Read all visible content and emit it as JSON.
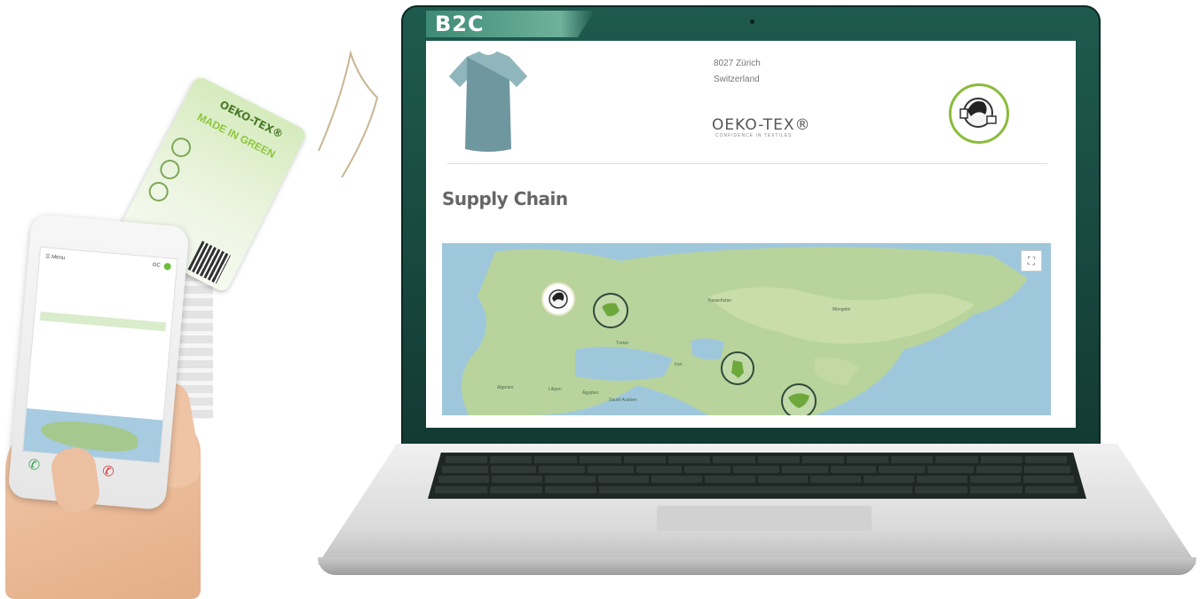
{
  "laptop": {
    "banner_label": "B2C",
    "page": {
      "address_line1": "8027 Zürich",
      "address_line2": "Switzerland",
      "logo_text": "OEKO-TEX®",
      "logo_subtitle": "CONFIDENCE IN TEXTILES",
      "section_title": "Supply Chain",
      "map": {
        "fullscreen_icon": "fullscreen-icon",
        "labels": [
          "Kasachstan",
          "Mongolei",
          "Saudi-Arabien",
          "Algerien",
          "Libyen",
          "Ägypten",
          "Türkei",
          "Iran"
        ]
      }
    }
  },
  "hangtag": {
    "brand": "OEKO-TEX®",
    "tagline": "MADE IN GREEN"
  },
  "phone": {
    "menu_label": "Menu",
    "status_label": "OC"
  }
}
